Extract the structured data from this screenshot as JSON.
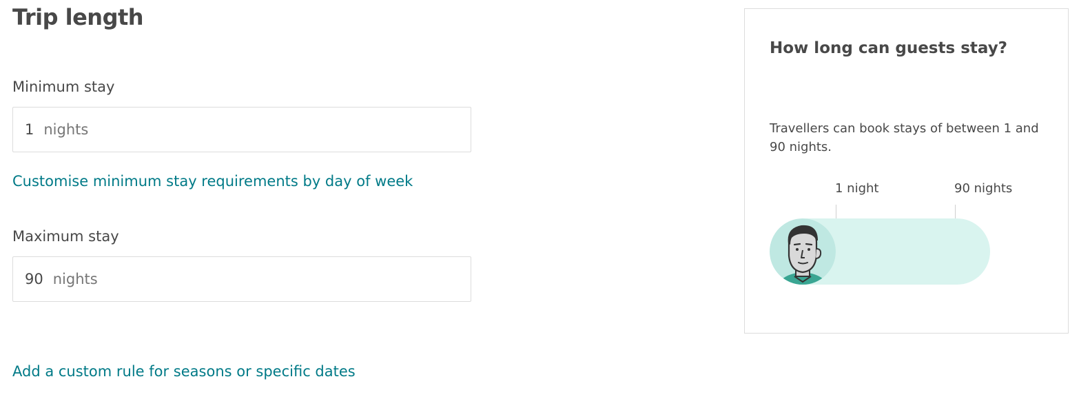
{
  "page": {
    "title": "Trip length"
  },
  "minimum_stay": {
    "label": "Minimum stay",
    "value": "1",
    "unit": "nights",
    "customise_link": "Customise minimum stay requirements by day of week"
  },
  "maximum_stay": {
    "label": "Maximum stay",
    "value": "90",
    "unit": "nights"
  },
  "custom_rule_link": "Add a custom rule for seasons or specific dates",
  "info_panel": {
    "title": "How long can guests stay?",
    "description": "Travellers can book stays of between 1 and 90 nights.",
    "range": {
      "min_label": "1 night",
      "max_label": "90 nights"
    },
    "icon": "guest-avatar-icon"
  },
  "colors": {
    "link": "#007a87",
    "track": "#d9f4ef",
    "text": "#484848"
  }
}
